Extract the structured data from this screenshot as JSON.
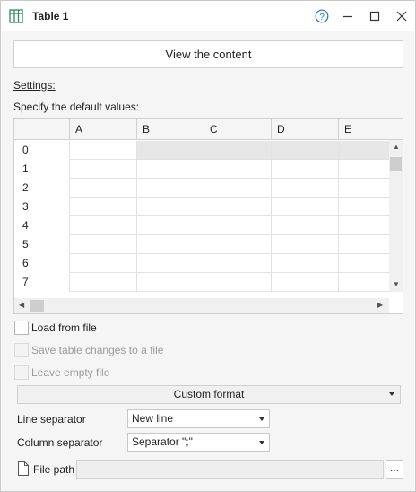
{
  "window": {
    "title": "Table 1",
    "icon": "table-icon",
    "controls": [
      "help-icon",
      "minimize-icon",
      "maximize-icon",
      "close-icon"
    ]
  },
  "main": {
    "view_button_label": "View the content",
    "settings_label": "Settings:",
    "default_values_label": "Specify the default values:"
  },
  "grid": {
    "columns": [
      "A",
      "B",
      "C",
      "D",
      "E"
    ],
    "rows": [
      "0",
      "1",
      "2",
      "3",
      "4",
      "5",
      "6",
      "7"
    ]
  },
  "options": {
    "load_from_file": "Load from file",
    "save_changes": "Save table changes to a file",
    "leave_empty": "Leave empty file"
  },
  "format": {
    "custom_format_label": "Custom format",
    "line_separator_label": "Line separator",
    "line_separator_value": "New line",
    "column_separator_label": "Column separator",
    "column_separator_value": "Separator \";\""
  },
  "file": {
    "label": "File path",
    "value": "",
    "browse_label": "..."
  },
  "colors": {
    "accent": "#1e73c8",
    "icon_green": "#2e8b57"
  }
}
